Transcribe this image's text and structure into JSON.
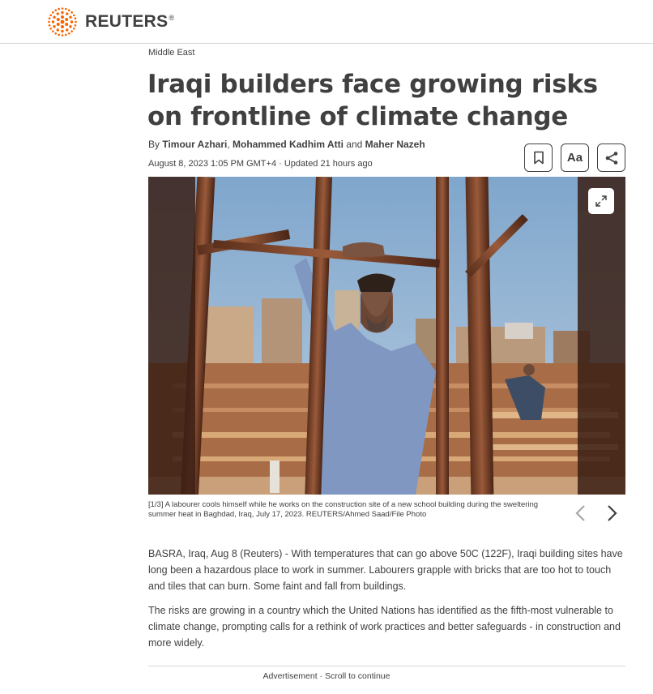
{
  "brand": {
    "name": "REUTERS",
    "reg": "®",
    "color": "#fa6400"
  },
  "article": {
    "section": "Middle East",
    "headline": "Iraqi builders face growing risks on frontline of climate change",
    "byline": {
      "prefix": "By ",
      "author1": "Timour Azhari",
      "sep1": ", ",
      "author2": "Mohammed Kadhim Atti",
      "sep2": " and ",
      "author3": "Maher Nazeh"
    },
    "dateline": "August 8, 2023 1:05 PM GMT+4 · Updated 21 hours ago",
    "tools": {
      "text_size_label": "Aa"
    },
    "photo": {
      "caption": "[1/3] A labourer cools himself while he works on the construction site of a new school building during the sweltering summer heat in Baghdad, Iraq, July 17, 2023. REUTERS/Ahmed Saad/File Photo"
    },
    "paragraphs": [
      "BASRA, Iraq, Aug 8 (Reuters) - With temperatures that can go above 50C (122F), Iraqi building sites have long been a hazardous place to work in summer. Labourers grapple with bricks that are too hot to touch and tiles that can burn. Some faint and fall from buildings.",
      "The risks are growing in a country which the United Nations has identified as the fifth-most vulnerable to climate change, prompting calls for a rethink of work practices and better safeguards - in construction and more widely."
    ],
    "ad_notice": "Advertisement · Scroll to continue"
  },
  "icons": {
    "logo": "reuters-dot-logo",
    "bookmark": "bookmark-icon",
    "share": "share-icon",
    "expand": "expand-icon",
    "prev": "chevron-left-icon",
    "next": "chevron-right-icon"
  }
}
